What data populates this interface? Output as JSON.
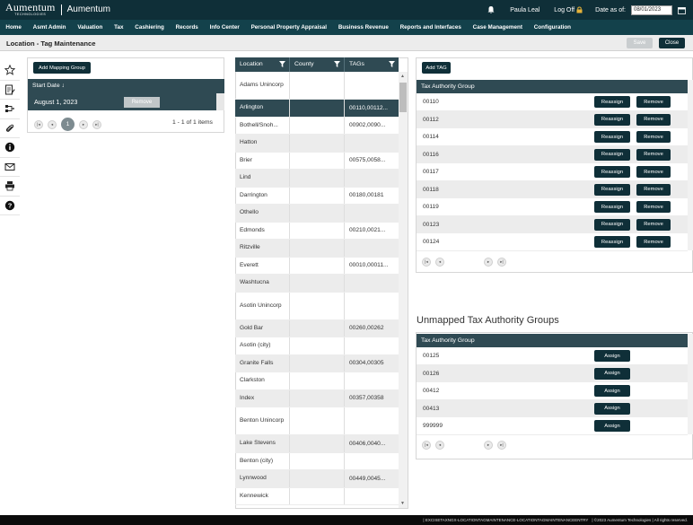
{
  "header": {
    "logo_text": "Aumentum",
    "logo_sub": "TECHNOLOGIES",
    "app_title": "Aumentum",
    "user": "Paula Leal",
    "logoff": "Log Off",
    "date_label": "Date as of:",
    "date_value": "08/01/2023"
  },
  "menu": [
    "Home",
    "Asmt Admin",
    "Valuation",
    "Tax",
    "Cashiering",
    "Records",
    "Info Center",
    "Personal Property Appraisal",
    "Business Revenue",
    "Reports and Interfaces",
    "Case Management",
    "Configuration"
  ],
  "page": {
    "title": "Location - Tag Maintenance",
    "save_label": "Save",
    "close_label": "Close"
  },
  "mapping": {
    "add_label": "Add Mapping Group",
    "header": "Start Date ↓",
    "row_date": "August 1, 2023",
    "remove_label": "Remove",
    "page_num": "1",
    "count": "1 - 1 of 1 items"
  },
  "locations": {
    "headers": [
      "Location",
      "County",
      "TAGs"
    ],
    "rows": [
      {
        "location": "Adams Unincorp",
        "county": "",
        "tags": ""
      },
      {
        "location": "Arlington",
        "county": "",
        "tags": "00110,00112..."
      },
      {
        "location": "Bothell/Snoh...",
        "county": "",
        "tags": "00902,0090..."
      },
      {
        "location": "Hatton",
        "county": "",
        "tags": ""
      },
      {
        "location": "Brier",
        "county": "",
        "tags": "00575,0058..."
      },
      {
        "location": "Lind",
        "county": "",
        "tags": ""
      },
      {
        "location": "Darrington",
        "county": "",
        "tags": "00180,00181"
      },
      {
        "location": "Othello",
        "county": "",
        "tags": ""
      },
      {
        "location": "Edmonds",
        "county": "",
        "tags": "00210,0021..."
      },
      {
        "location": "Ritzville",
        "county": "",
        "tags": ""
      },
      {
        "location": "Everett",
        "county": "",
        "tags": "00010,00011..."
      },
      {
        "location": "Washtucna",
        "county": "",
        "tags": ""
      },
      {
        "location": "Asotin Unincorp",
        "county": "",
        "tags": ""
      },
      {
        "location": "Gold Bar",
        "county": "",
        "tags": "00260,00262"
      },
      {
        "location": "Asotin (city)",
        "county": "",
        "tags": ""
      },
      {
        "location": "Granite Falls",
        "county": "",
        "tags": "00304,00305"
      },
      {
        "location": "Clarkston",
        "county": "",
        "tags": ""
      },
      {
        "location": "Index",
        "county": "",
        "tags": "00357,00358"
      },
      {
        "location": "Benton Unincorp",
        "county": "",
        "tags": ""
      },
      {
        "location": "Lake Stevens",
        "county": "",
        "tags": "00406,0040..."
      },
      {
        "location": "Benton (city)",
        "county": "",
        "tags": ""
      },
      {
        "location": "Lynnwood",
        "county": "",
        "tags": "00449,0045..."
      },
      {
        "location": "Kennewick",
        "county": "",
        "tags": ""
      }
    ]
  },
  "tag_groups": {
    "add_label": "Add TAG",
    "header": "Tax Authority Group",
    "reassign_label": "Reassign",
    "remove_label": "Remove",
    "rows": [
      "00110",
      "00112",
      "00114",
      "00116",
      "00117",
      "00118",
      "00119",
      "00123",
      "00124"
    ]
  },
  "unmapped": {
    "title": "Unmapped Tax Authority Groups",
    "header": "Tax Authority Group",
    "assign_label": "Assign",
    "rows": [
      "00125",
      "00126",
      "00412",
      "00413",
      "999999"
    ]
  },
  "footer": {
    "path": "| EXCISETAXNGX-LOCATIONTAGMAINTENANCE-LOCATIONTAGMAINTENANCEENTRY",
    "copyright": "| ©2023 Aumentum Technologies | All rights reserved."
  }
}
